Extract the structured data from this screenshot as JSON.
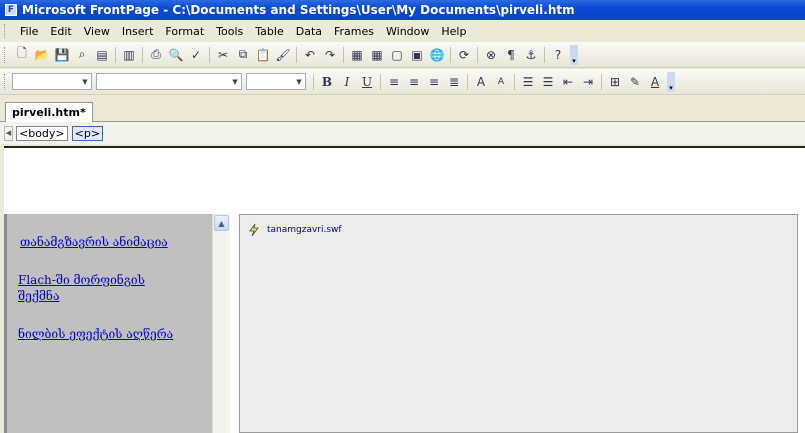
{
  "window": {
    "title": "Microsoft FrontPage - C:\\Documents and Settings\\User\\My Documents\\pirveli.htm"
  },
  "menu": [
    "File",
    "Edit",
    "View",
    "Insert",
    "Format",
    "Tools",
    "Table",
    "Data",
    "Frames",
    "Window",
    "Help"
  ],
  "standard_toolbar": [
    "new",
    "open",
    "save",
    "search",
    "publish",
    "toggle-pane",
    "print",
    "print-preview",
    "spelling",
    "cut",
    "copy",
    "paste",
    "format-painter",
    "undo",
    "redo",
    "web-component",
    "insert-table",
    "insert-layer",
    "insert-picture",
    "hyperlink",
    "refresh",
    "stop",
    "show-all",
    "help"
  ],
  "formatting_toolbar": [
    "style",
    "font",
    "size",
    "bold",
    "italic",
    "underline",
    "align-left",
    "center",
    "align-right",
    "justify",
    "increase-font",
    "decrease-font",
    "numbering",
    "bullets",
    "decrease-indent",
    "increase-indent",
    "borders",
    "highlight",
    "font-color"
  ],
  "formatting_labels": {
    "bold": "B",
    "italic": "I",
    "underline": "U"
  },
  "document_tab": {
    "label": "pirveli.htm*"
  },
  "quick_tag": [
    "<body>",
    "<p>"
  ],
  "left_frame": {
    "links": [
      "თანამგზავრის ანიმაცია",
      "Flach-ში მორფინგის შექმნა",
      "ნილბის ეფექტის აღწერა"
    ]
  },
  "right_frame": {
    "embedded_file": "tanamgzavri.swf"
  },
  "colors": {
    "titlebar": "#0a4bd4",
    "link": "#0000cc",
    "left_frame_bg": "#c0c0c0",
    "right_frame_bg": "#ececec"
  }
}
